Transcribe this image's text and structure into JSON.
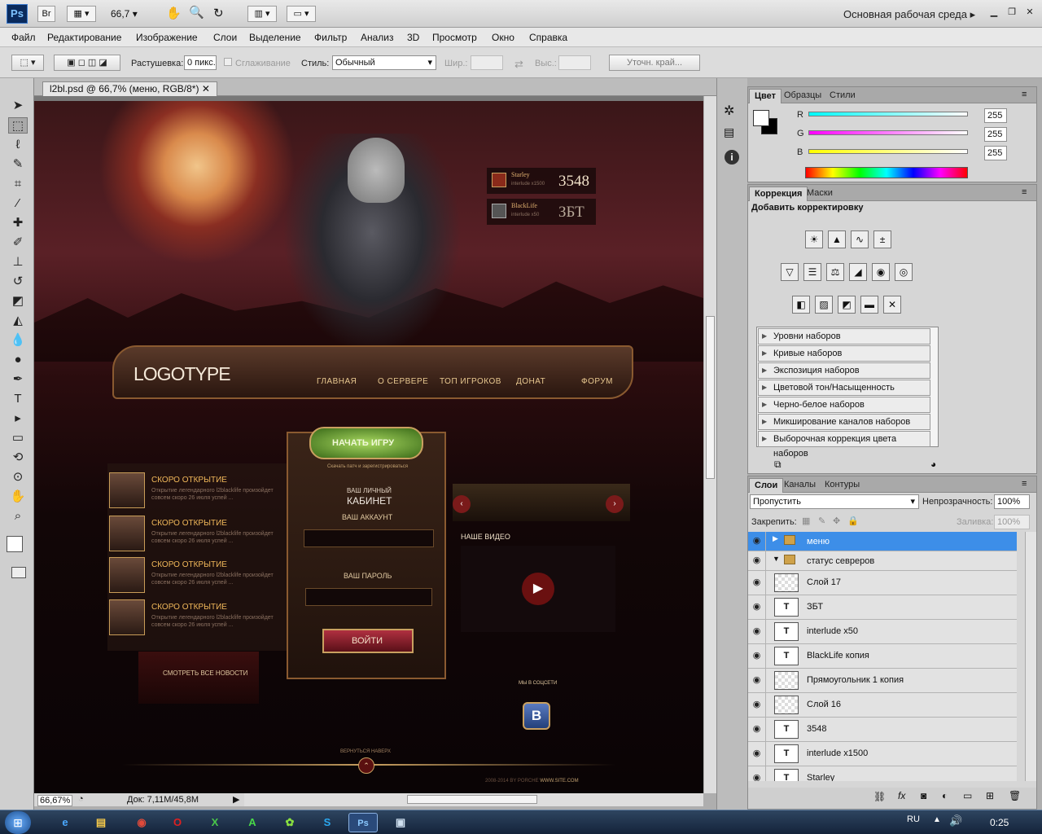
{
  "app": {
    "logo": "Ps",
    "zoom": "66,7",
    "workspace": "Основная рабочая среда"
  },
  "menu": [
    "Файл",
    "Редактирование",
    "Изображение",
    "Слои",
    "Выделение",
    "Фильтр",
    "Анализ",
    "3D",
    "Просмотр",
    "Окно",
    "Справка"
  ],
  "options": {
    "feather_label": "Растушевка:",
    "feather_value": "0 пикс.",
    "antialias_label": "Сглаживание",
    "style_label": "Стиль:",
    "style_value": "Обычный",
    "width_label": "Шир.:",
    "height_label": "Выс.:",
    "refine_label": "Уточн. край..."
  },
  "document": {
    "tab_title": "l2bl.psd @ 66,7% (меню, RGB/8*)",
    "zoom": "66,67%",
    "doc_info": "Док: 7,11M/45,8M"
  },
  "color_panel": {
    "tabs": [
      "Цвет",
      "Образцы",
      "Стили"
    ],
    "r_label": "R",
    "g_label": "G",
    "b_label": "B",
    "r": "255",
    "g": "255",
    "b": "255"
  },
  "adjust_panel": {
    "tabs": [
      "Коррекция",
      "Маски"
    ],
    "heading": "Добавить корректировку",
    "presets": [
      "Уровни наборов",
      "Кривые наборов",
      "Экспозиция наборов",
      "Цветовой тон/Насыщенность наборов",
      "Черно-белое наборов",
      "Микширование каналов наборов",
      "Выборочная коррекция цвета наборов"
    ]
  },
  "layers_panel": {
    "tabs": [
      "Слои",
      "Каналы",
      "Контуры"
    ],
    "blend_mode": "Пропустить",
    "opacity_label": "Непрозрачность:",
    "opacity": "100%",
    "lock_label": "Закрепить:",
    "fill_label": "Заливка:",
    "fill": "100%",
    "layers": [
      {
        "name": "меню",
        "kind": "group",
        "selected": true
      },
      {
        "name": "статус севреров",
        "kind": "group-open"
      },
      {
        "name": "Слой 17",
        "kind": "pixel"
      },
      {
        "name": "ЗБТ",
        "kind": "text"
      },
      {
        "name": "interlude x50",
        "kind": "text"
      },
      {
        "name": "BlackLife копия",
        "kind": "text"
      },
      {
        "name": "Прямоугольник 1 копия",
        "kind": "pixel"
      },
      {
        "name": "Слой 16",
        "kind": "pixel"
      },
      {
        "name": "3548",
        "kind": "text"
      },
      {
        "name": "interlude x1500",
        "kind": "text"
      },
      {
        "name": "Starley",
        "kind": "text"
      }
    ]
  },
  "artwork": {
    "servers": [
      {
        "name": "Starley",
        "rate": "interlude x1500",
        "value": "3548"
      },
      {
        "name": "BlackLife",
        "rate": "interlude x50",
        "value": "ЗБТ"
      }
    ],
    "logo": "LOGOTYPE",
    "nav": [
      "ГЛАВНАЯ",
      "О СЕРВЕРЕ",
      "ТОП ИГРОКОВ",
      "ДОНАТ",
      "ФОРУМ"
    ],
    "start_button": "НАЧАТЬ ИГРУ",
    "start_sub": "Скачать патч и зарегистрироваться",
    "cabinet_pre": "ВАШ ЛИЧНЫЙ",
    "cabinet": "КАБИНЕТ",
    "account": "ВАШ АККАУНТ",
    "password": "ВАШ ПАРОЛЬ",
    "login": "ВОЙТИ",
    "news_title": "СКОРО ОТКРЫТИЕ",
    "news_text": "Открытие легендарного l2blacklife произойдет совсем скоро 26 июля успей ...",
    "all_news": "СМОТРЕТЬ ВСЕ НОВОСТИ",
    "video_title": "НАШЕ ВИДЕО",
    "social": "МЫ В СОЦСЕТИ",
    "vk": "В",
    "back_top": "ВЕРНУТЬСЯ НАВЕРХ",
    "copyright": "2008-2014 BY PORCHE",
    "site": "WWW.SITE.COM"
  },
  "taskbar": {
    "lang": "RU",
    "time": "0:25"
  }
}
